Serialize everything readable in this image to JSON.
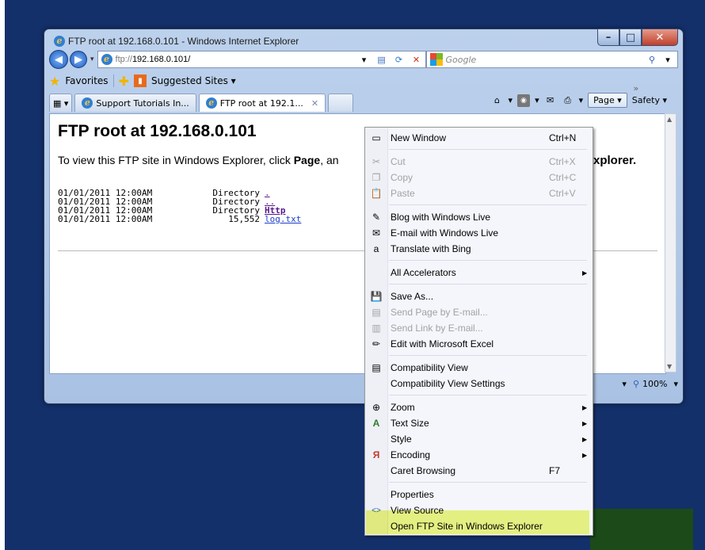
{
  "window": {
    "title": "FTP root at 192.168.0.101 - Windows Internet Explorer",
    "address_proto": "ftp://",
    "address_host": "192.168.0.101/",
    "search_placeholder": "Google"
  },
  "favorites_bar": {
    "favorites_label": "Favorites",
    "suggested_label": "Suggested Sites ▾"
  },
  "tabs": [
    {
      "label": "Support Tutorials In..."
    },
    {
      "label": "FTP root at 192.1..."
    }
  ],
  "tab_tools": {
    "page_label": "Page ▾",
    "safety_label": "Safety ▾"
  },
  "content": {
    "heading": "FTP root at 192.168.0.101",
    "intro_pre": "To view this FTP site in Windows Explorer, click ",
    "intro_bold": "Page",
    "intro_post": ", an",
    "intro_tail": "xplorer.",
    "listing": [
      {
        "date": "01/01/2011 12:00AM",
        "kind": "Directory",
        "name": "."
      },
      {
        "date": "01/01/2011 12:00AM",
        "kind": "Directory",
        "name": ".."
      },
      {
        "date": "01/01/2011 12:00AM",
        "kind": "Directory",
        "name": "Http"
      },
      {
        "date": "01/01/2011 12:00AM",
        "kind": "15,552",
        "name": "log.txt"
      }
    ]
  },
  "status": {
    "zoom": "100%"
  },
  "menu": {
    "items": [
      {
        "label": "New Window",
        "shortcut": "Ctrl+N"
      },
      {
        "label": "Cut",
        "shortcut": "Ctrl+X"
      },
      {
        "label": "Copy",
        "shortcut": "Ctrl+C"
      },
      {
        "label": "Paste",
        "shortcut": "Ctrl+V"
      },
      {
        "label": "Blog with Windows Live"
      },
      {
        "label": "E-mail with Windows Live"
      },
      {
        "label": "Translate with Bing"
      },
      {
        "label": "All Accelerators"
      },
      {
        "label": "Save As..."
      },
      {
        "label": "Send Page by E-mail..."
      },
      {
        "label": "Send Link by E-mail..."
      },
      {
        "label": "Edit with Microsoft Excel"
      },
      {
        "label": "Compatibility View"
      },
      {
        "label": "Compatibility View Settings"
      },
      {
        "label": "Zoom"
      },
      {
        "label": "Text Size"
      },
      {
        "label": "Style"
      },
      {
        "label": "Encoding"
      },
      {
        "label": "Caret Browsing",
        "shortcut": "F7"
      },
      {
        "label": "Properties"
      },
      {
        "label": "View Source"
      },
      {
        "label": "Open FTP Site in Windows Explorer"
      }
    ]
  },
  "colors": {
    "desktop": "#14306b",
    "highlight": "#ecf76e",
    "link_visited": "#551a8b"
  }
}
